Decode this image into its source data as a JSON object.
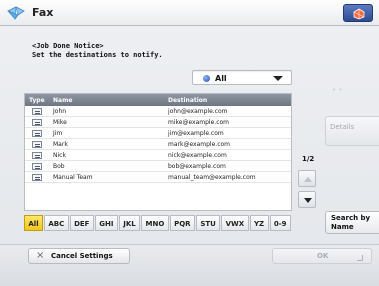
{
  "header": {
    "title": "Fax",
    "icon": "fax-icon",
    "top_right_icon": "settings-icon"
  },
  "notice": {
    "line1": "<Job Done Notice>",
    "line2": "Set the destinations to notify."
  },
  "filter": {
    "selected": "All",
    "icon": "radio-dot-icon"
  },
  "table": {
    "headers": [
      "Type",
      "Name",
      "Destination"
    ],
    "rows": [
      {
        "type_icon": "email-icon",
        "name": "John",
        "destination": "john@example.com"
      },
      {
        "type_icon": "email-icon",
        "name": "Mike",
        "destination": "mike@example.com"
      },
      {
        "type_icon": "email-icon",
        "name": "Jim",
        "destination": "jim@example.com"
      },
      {
        "type_icon": "email-icon",
        "name": "Mark",
        "destination": "mark@example.com"
      },
      {
        "type_icon": "email-icon",
        "name": "Nick",
        "destination": "nick@example.com"
      },
      {
        "type_icon": "email-icon",
        "name": "Bob",
        "destination": "bob@example.com"
      },
      {
        "type_icon": "email-icon",
        "name": "Manual Team",
        "destination": "manual_team@example.com"
      }
    ]
  },
  "pager": {
    "page": "1/2"
  },
  "right_panel": {
    "faint_glyph": "• •",
    "details_label": "Details",
    "details_chevron": "›",
    "search_by_label": "Search by Name"
  },
  "alphabet": [
    "All",
    "ABC",
    "DEF",
    "GHI",
    "JKL",
    "MNO",
    "PQR",
    "STU",
    "VWX",
    "YZ",
    "0-9"
  ],
  "alphabet_selected": "All",
  "footer": {
    "cancel_label": "Cancel Settings",
    "ok_label": "OK"
  },
  "colors": {
    "accent_active": "#f2c51b",
    "header_table": "#7f8795",
    "brand_button": "#2d4a8f"
  }
}
